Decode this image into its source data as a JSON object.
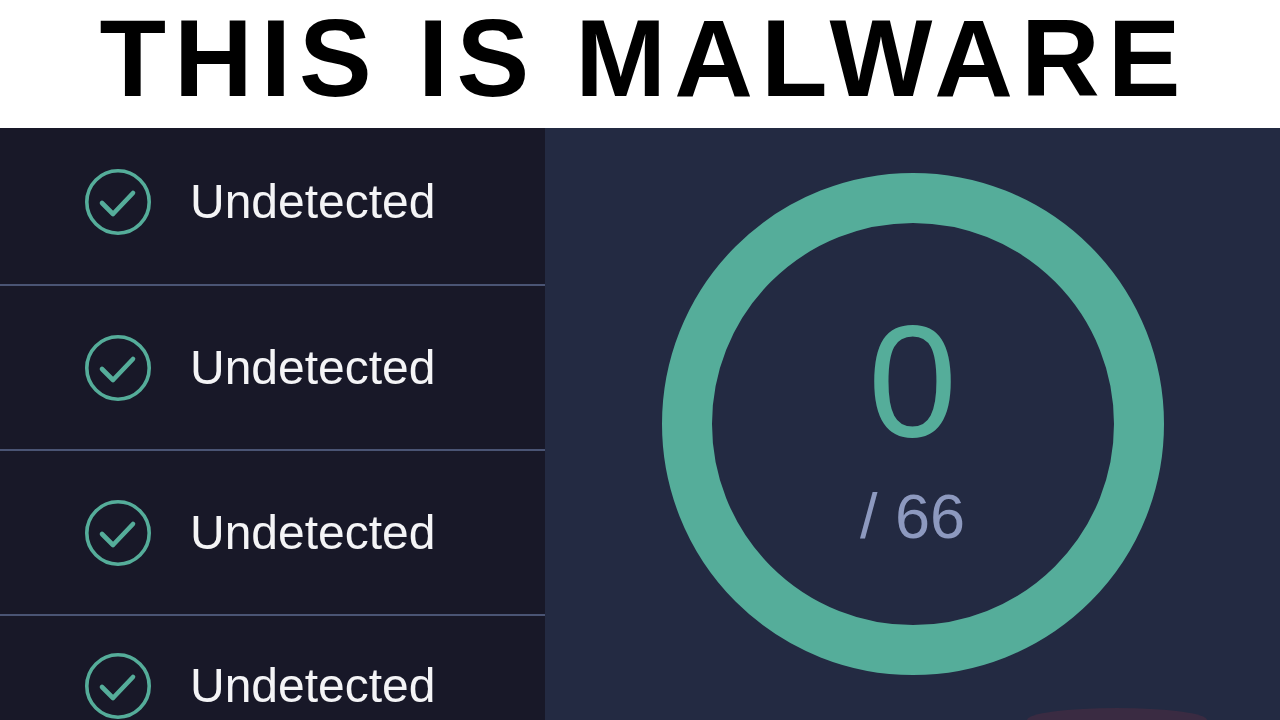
{
  "caption": "THIS IS MALWARE",
  "results": [
    {
      "label": "Undetected",
      "detected": false
    },
    {
      "label": "Undetected",
      "detected": false
    },
    {
      "label": "Undetected",
      "detected": false
    },
    {
      "label": "Undetected",
      "detected": false
    }
  ],
  "score": {
    "detections": "0",
    "total": "/ 66"
  }
}
